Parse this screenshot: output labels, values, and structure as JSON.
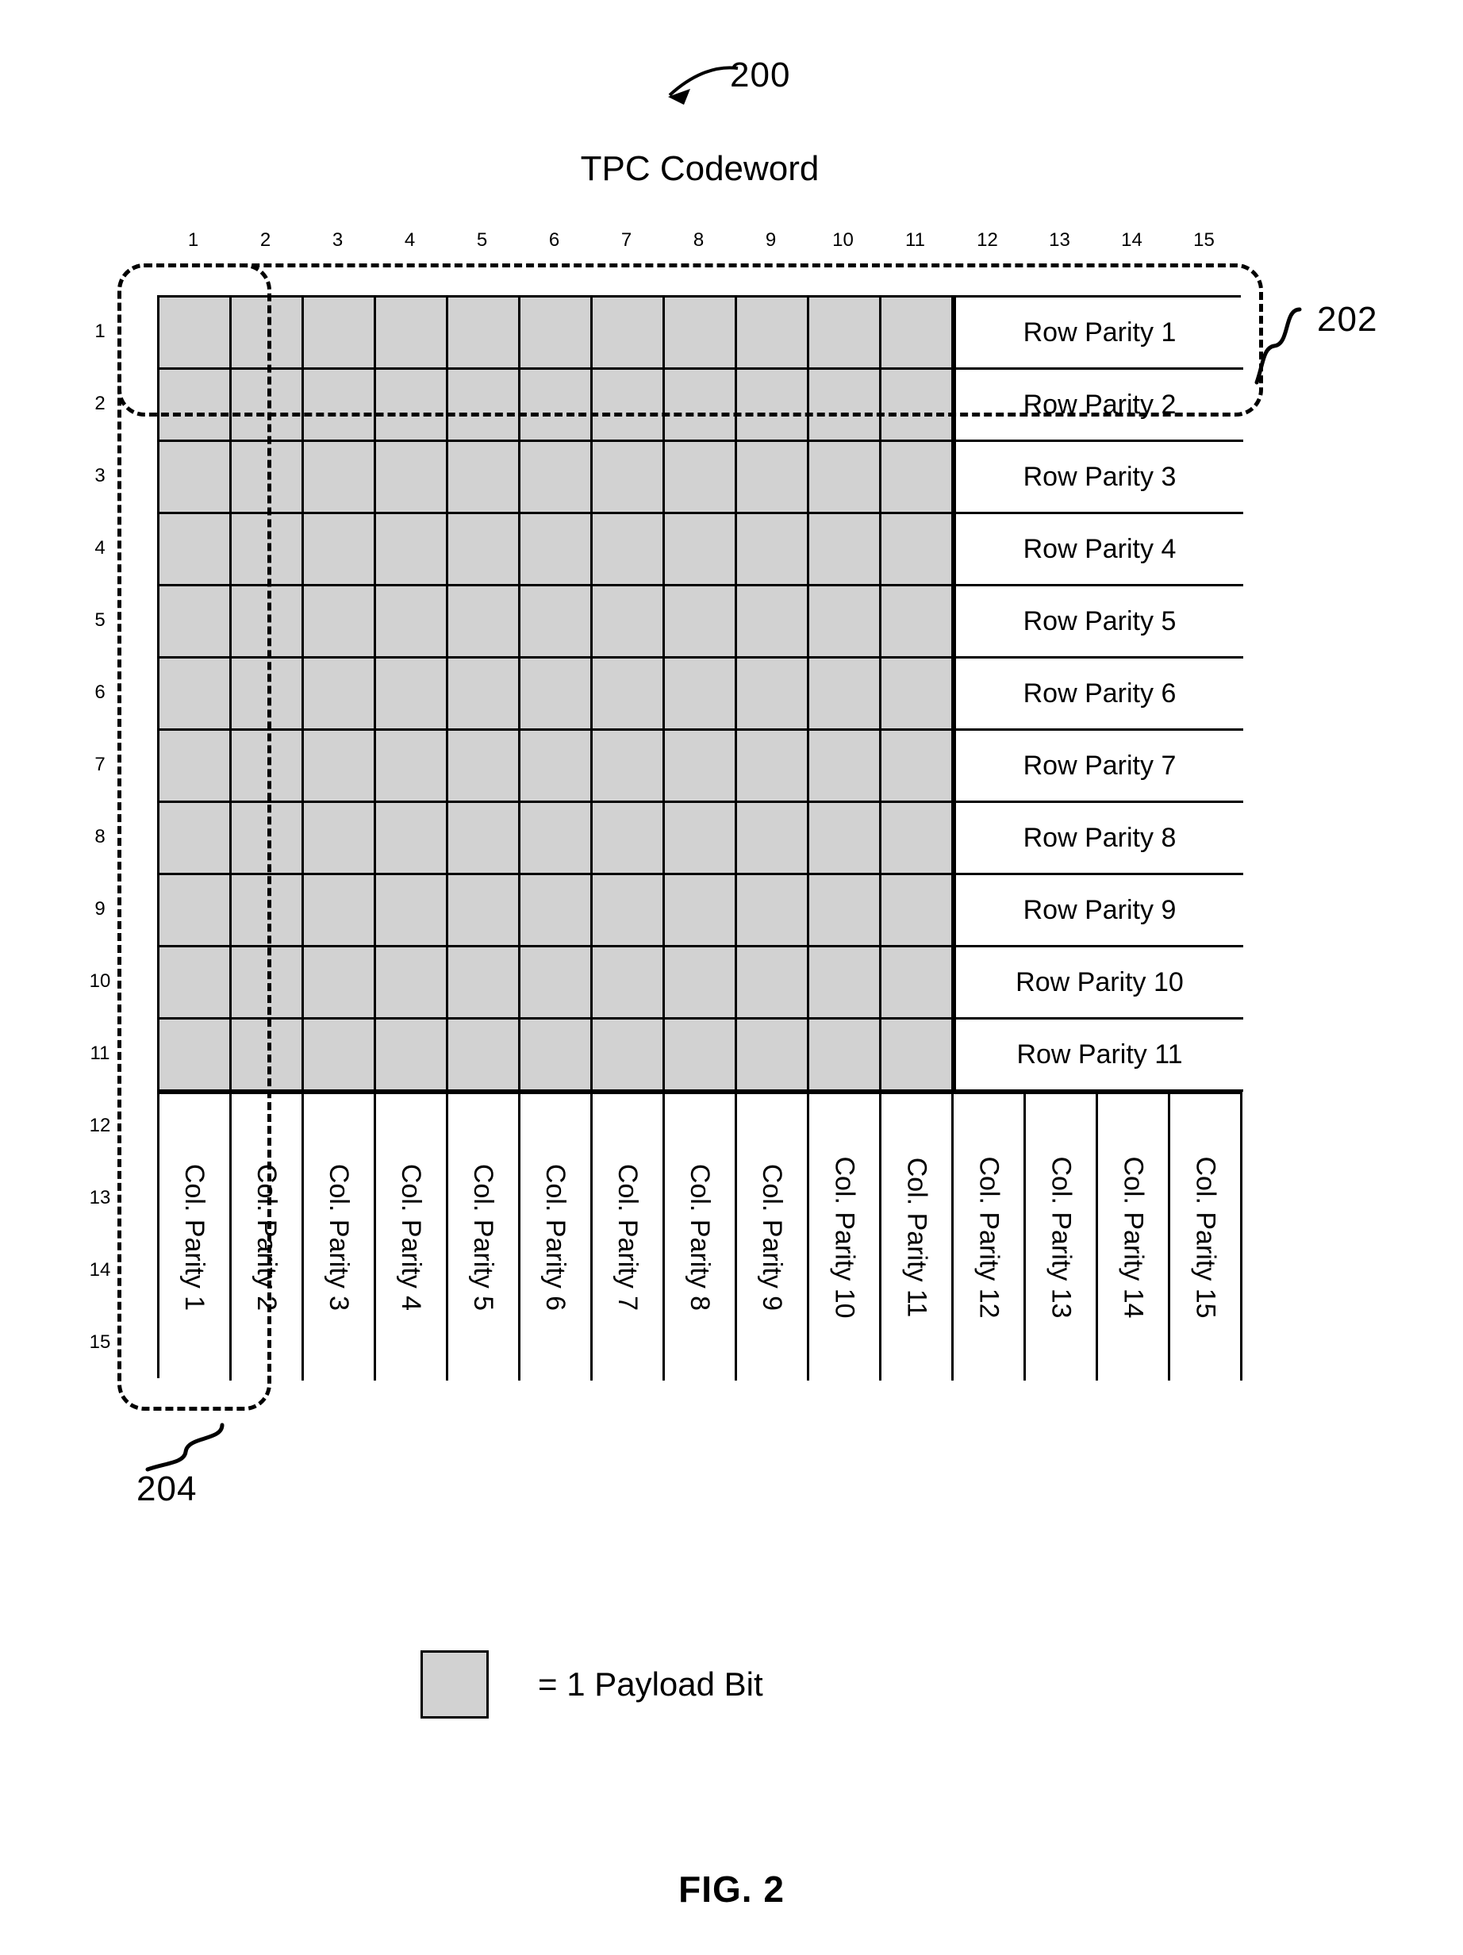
{
  "figure": {
    "reference_numeral_main": "200",
    "title": "TPC Codeword",
    "caption": "FIG. 2"
  },
  "callouts": {
    "row_callout_numeral": "202",
    "col_callout_numeral": "204"
  },
  "grid": {
    "rows": 15,
    "columns": 15,
    "payload_rows": 11,
    "payload_columns": 11,
    "column_headers": [
      "1",
      "2",
      "3",
      "4",
      "5",
      "6",
      "7",
      "8",
      "9",
      "10",
      "11",
      "12",
      "13",
      "14",
      "15"
    ],
    "row_headers": [
      "1",
      "2",
      "3",
      "4",
      "5",
      "6",
      "7",
      "8",
      "9",
      "10",
      "11",
      "12",
      "13",
      "14",
      "15"
    ],
    "row_parity_labels": [
      "Row Parity 1",
      "Row Parity 2",
      "Row Parity 3",
      "Row Parity 4",
      "Row Parity 5",
      "Row Parity 6",
      "Row Parity 7",
      "Row Parity 8",
      "Row Parity 9",
      "Row Parity 10",
      "Row Parity 11"
    ],
    "col_parity_labels": [
      "Col. Parity 1",
      "Col. Parity 2",
      "Col. Parity 3",
      "Col. Parity 4",
      "Col. Parity 5",
      "Col. Parity 6",
      "Col. Parity 7",
      "Col. Parity 8",
      "Col. Parity 9",
      "Col. Parity 10",
      "Col. Parity 11",
      "Col. Parity 12",
      "Col. Parity 13",
      "Col. Parity 14",
      "Col. Parity 15"
    ]
  },
  "legend": {
    "text": "= 1 Payload Bit",
    "swatch_color": "#d2d2d2"
  },
  "colors": {
    "payload_fill": "#d2d2d2",
    "line": "#000000",
    "background": "#ffffff"
  }
}
